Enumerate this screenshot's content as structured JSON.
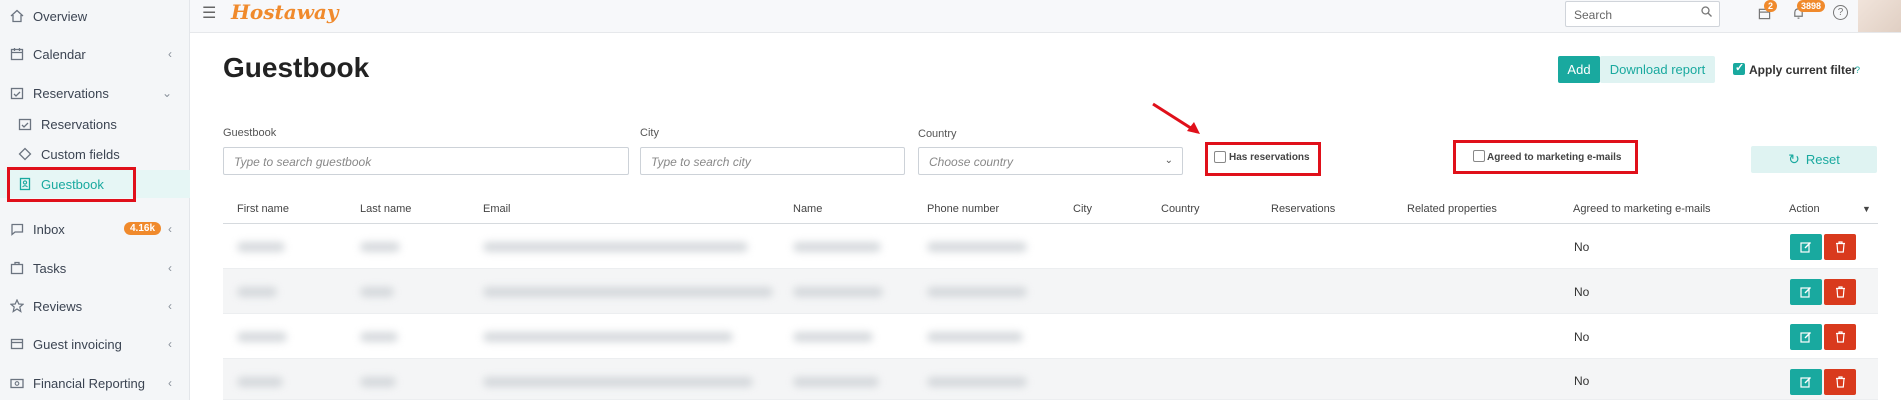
{
  "sidebar": {
    "items": [
      {
        "label": "Overview",
        "icon": "home-icon"
      },
      {
        "label": "Calendar",
        "icon": "calendar-icon"
      },
      {
        "label": "Reservations",
        "icon": "reservations-icon"
      },
      {
        "label": "Reservations",
        "icon": "reservations-sub-icon"
      },
      {
        "label": "Custom fields",
        "icon": "tag-icon"
      },
      {
        "label": "Guestbook",
        "icon": "guestbook-icon"
      },
      {
        "label": "Inbox",
        "icon": "inbox-icon",
        "badge": "4.16k"
      },
      {
        "label": "Tasks",
        "icon": "tasks-icon"
      },
      {
        "label": "Reviews",
        "icon": "star-icon"
      },
      {
        "label": "Guest invoicing",
        "icon": "invoice-icon"
      },
      {
        "label": "Financial Reporting",
        "icon": "money-icon"
      }
    ]
  },
  "topbar": {
    "logo": "Hostaway",
    "search_placeholder": "Search",
    "calendar_badge": "2",
    "notifications_badge": "3898"
  },
  "page": {
    "title": "Guestbook",
    "add_label": "Add",
    "download_label": "Download report",
    "apply_filter_label": "Apply current filter",
    "apply_filter_checked": true
  },
  "filters": {
    "guestbook_label": "Guestbook",
    "guestbook_placeholder": "Type to search guestbook",
    "city_label": "City",
    "city_placeholder": "Type to search city",
    "country_label": "Country",
    "country_placeholder": "Choose country",
    "has_reservations_label": "Has reservations",
    "agreed_marketing_label": "Agreed to marketing e-mails",
    "reset_label": "Reset"
  },
  "table": {
    "columns": [
      "First name",
      "Last name",
      "Email",
      "Name",
      "Phone number",
      "City",
      "Country",
      "Reservations",
      "Related properties",
      "Agreed to marketing e-mails",
      "Action"
    ],
    "rows": [
      {
        "agreed": "No"
      },
      {
        "agreed": "No"
      },
      {
        "agreed": "No"
      },
      {
        "agreed": "No"
      }
    ]
  },
  "colors": {
    "accent": "#19a99f",
    "brand": "#f08a2c",
    "danger": "#d93a1d",
    "highlight": "#e0101a"
  }
}
